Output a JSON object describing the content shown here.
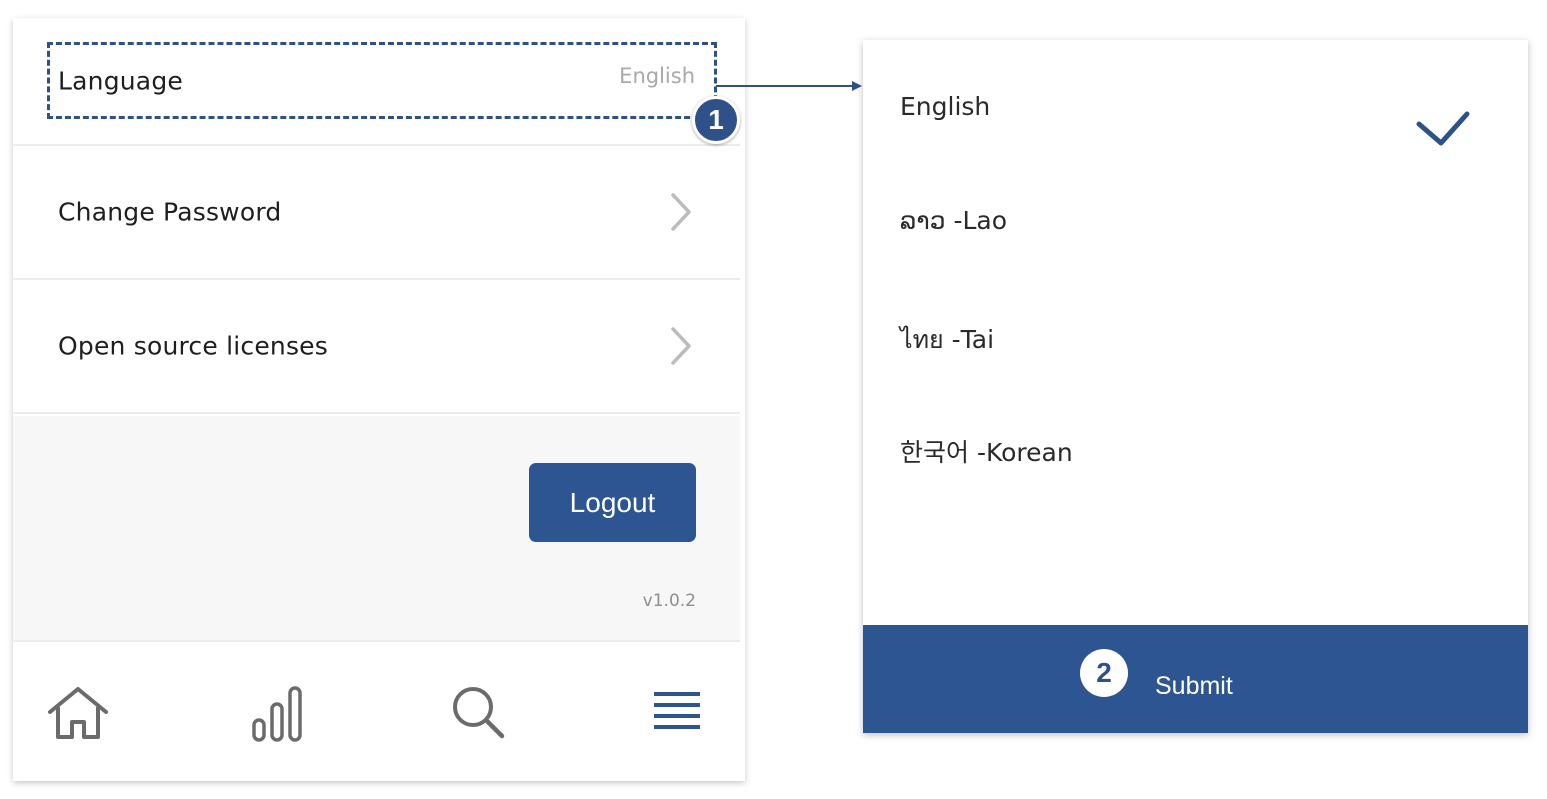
{
  "settings": {
    "language_label": "Language",
    "language_value": "English",
    "change_password_label": "Change Password",
    "open_source_label": "Open source licenses",
    "logout_label": "Logout",
    "version": "v1.0.2"
  },
  "tabbar": {
    "items": [
      {
        "icon": "home-icon"
      },
      {
        "icon": "bar-chart-icon"
      },
      {
        "icon": "search-icon"
      },
      {
        "icon": "menu-icon"
      }
    ]
  },
  "callouts": {
    "step1": "1",
    "step2": "2"
  },
  "language_sheet": {
    "options": [
      {
        "label": "English",
        "selected": true
      },
      {
        "label": "ລາວ -Lao",
        "selected": false
      },
      {
        "label": "ไทย -Tai",
        "selected": false
      },
      {
        "label": "한국어 -Korean",
        "selected": false
      }
    ],
    "submit_label": "Submit"
  },
  "colors": {
    "primary": "#2d5591",
    "callout": "#2d5188",
    "muted_text": "#a9a9a9",
    "icon_gray": "#6b6b6b"
  }
}
